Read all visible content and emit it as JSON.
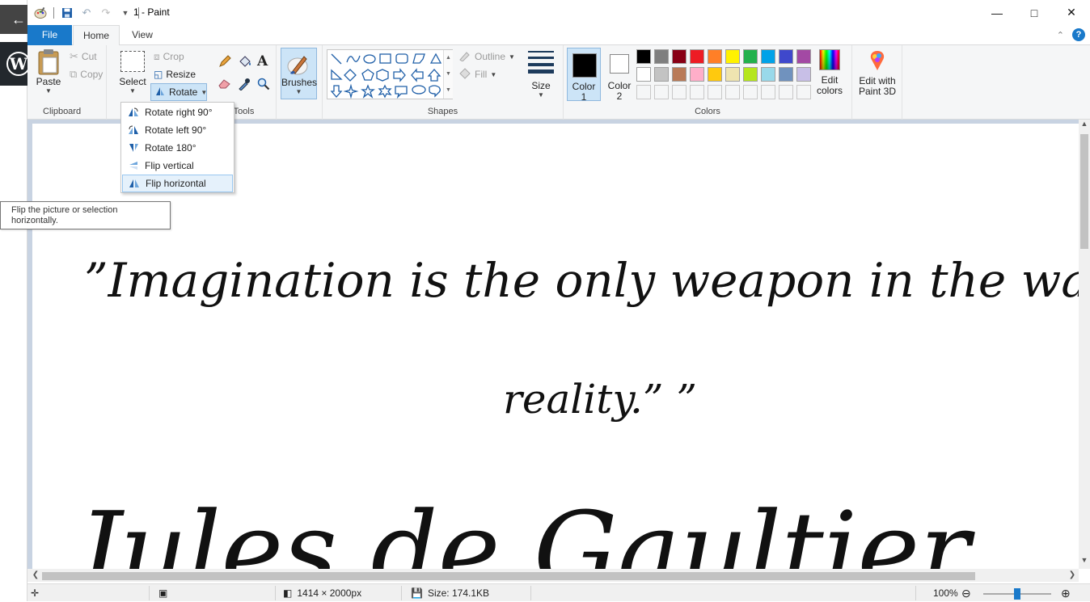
{
  "window": {
    "title": "1 - Paint"
  },
  "tabs": {
    "file": "File",
    "home": "Home",
    "view": "View"
  },
  "clipboard": {
    "group": "Clipboard",
    "paste": "Paste",
    "cut": "Cut",
    "copy": "Copy"
  },
  "image": {
    "select": "Select",
    "crop": "Crop",
    "resize": "Resize",
    "rotate": "Rotate"
  },
  "tools": {
    "group": "Tools"
  },
  "brushes": {
    "label": "Brushes"
  },
  "shapes": {
    "group": "Shapes",
    "outline": "Outline",
    "fill": "Fill"
  },
  "size": {
    "label": "Size"
  },
  "colors": {
    "group": "Colors",
    "color1_label": "Color",
    "color1_num": "1",
    "color2_label": "Color",
    "color2_num": "2",
    "edit_colors_line1": "Edit",
    "edit_colors_line2": "colors",
    "paint3d_line1": "Edit with",
    "paint3d_line2": "Paint 3D",
    "color1_value": "#000000",
    "color2_value": "#ffffff",
    "row1": [
      "#000000",
      "#7f7f7f",
      "#880015",
      "#ed1c24",
      "#ff7f27",
      "#fff200",
      "#22b14c",
      "#00a2e8",
      "#3f48cc",
      "#a349a4"
    ],
    "row2": [
      "#ffffff",
      "#c3c3c3",
      "#b97a57",
      "#ffaec9",
      "#ffc90e",
      "#efe4b0",
      "#b5e61d",
      "#99d9ea",
      "#7092be",
      "#c8bfe7"
    ]
  },
  "rotate_menu": {
    "items": [
      {
        "label": "Rotate right 90°",
        "icon": "rotate-right-icon"
      },
      {
        "label": "Rotate left 90°",
        "icon": "rotate-left-icon"
      },
      {
        "label": "Rotate 180°",
        "icon": "rotate-180-icon"
      },
      {
        "label": "Flip vertical",
        "icon": "flip-vertical-icon"
      },
      {
        "label": "Flip horizontal",
        "icon": "flip-horizontal-icon"
      }
    ],
    "highlighted": "Flip horizontal"
  },
  "tooltip": {
    "line1": "Flip the picture or selection",
    "line2": "horizontally."
  },
  "canvas": {
    "line1": "”Imagination is the only weapon in the war w",
    "line2": "reality.” ”",
    "line3": "Jules de Gaultier"
  },
  "status": {
    "dimensions": "1414 × 2000px",
    "size": "Size: 174.1KB",
    "zoom": "100%"
  }
}
